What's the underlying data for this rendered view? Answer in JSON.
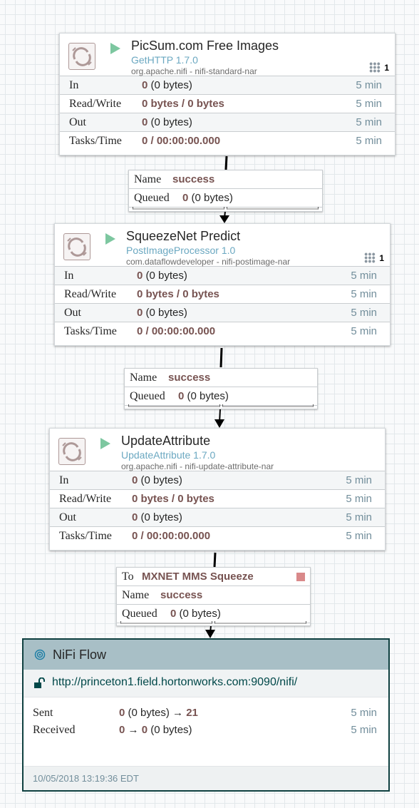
{
  "processors": [
    {
      "name": "PicSum.com Free Images",
      "type": "GetHTTP 1.7.0",
      "bundle": "org.apache.nifi - nifi-standard-nar",
      "active_tasks": "1",
      "stats": [
        {
          "label": "In",
          "bold": "0",
          "rest": " (0 bytes)",
          "time": "5 min"
        },
        {
          "label": "Read/Write",
          "bold": "0 bytes / 0 bytes",
          "rest": "",
          "time": "5 min"
        },
        {
          "label": "Out",
          "bold": "0",
          "rest": " (0 bytes)",
          "time": "5 min"
        },
        {
          "label": "Tasks/Time",
          "bold": "0 / 00:00:00.000",
          "rest": "",
          "time": "5 min"
        }
      ]
    },
    {
      "name": "SqueezeNet Predict",
      "type": "PostImageProcessor 1.0",
      "bundle": "com.dataflowdeveloper - nifi-postimage-nar",
      "active_tasks": "1",
      "stats": [
        {
          "label": "In",
          "bold": "0",
          "rest": " (0 bytes)",
          "time": "5 min"
        },
        {
          "label": "Read/Write",
          "bold": "0 bytes / 0 bytes",
          "rest": "",
          "time": "5 min"
        },
        {
          "label": "Out",
          "bold": "0",
          "rest": " (0 bytes)",
          "time": "5 min"
        },
        {
          "label": "Tasks/Time",
          "bold": "0 / 00:00:00.000",
          "rest": "",
          "time": "5 min"
        }
      ]
    },
    {
      "name": "UpdateAttribute",
      "type": "UpdateAttribute 1.7.0",
      "bundle": "org.apache.nifi - nifi-update-attribute-nar",
      "active_tasks": "",
      "stats": [
        {
          "label": "In",
          "bold": "0",
          "rest": " (0 bytes)",
          "time": "5 min"
        },
        {
          "label": "Read/Write",
          "bold": "0 bytes / 0 bytes",
          "rest": "",
          "time": "5 min"
        },
        {
          "label": "Out",
          "bold": "0",
          "rest": " (0 bytes)",
          "time": "5 min"
        },
        {
          "label": "Tasks/Time",
          "bold": "0 / 00:00:00.000",
          "rest": "",
          "time": "5 min"
        }
      ]
    }
  ],
  "connections": [
    {
      "name_label": "Name",
      "name_value": "success",
      "queued_label": "Queued",
      "queued_bold": "0",
      "queued_rest": " (0 bytes)"
    },
    {
      "name_label": "Name",
      "name_value": "success",
      "queued_label": "Queued",
      "queued_bold": "0",
      "queued_rest": " (0 bytes)"
    },
    {
      "to_label": "To",
      "to_value": "MXNET MMS Squeeze",
      "name_label": "Name",
      "name_value": "success",
      "queued_label": "Queued",
      "queued_bold": "0",
      "queued_rest": " (0 bytes)"
    }
  ],
  "remote_group": {
    "name": "NiFi Flow",
    "url": "http://princeton1.field.hortonworks.com:9090/nifi/",
    "sent_label": "Sent",
    "sent_bold_1": "0",
    "sent_mid": " (0 bytes) → ",
    "sent_bold_2": "21",
    "sent_time": "5 min",
    "received_label": "Received",
    "received_bold_1": "0",
    "received_mid": " → ",
    "received_bold_2": "0",
    "received_rest": " (0 bytes)",
    "received_time": "5 min",
    "last_refreshed": "10/05/2018 13:19:36 EDT"
  },
  "colors": {
    "run_icon": "#7dc7a0",
    "value_bold": "#775351",
    "time": "#728e9b",
    "type_link": "#6ba8c1",
    "stop": "#d9898a"
  }
}
